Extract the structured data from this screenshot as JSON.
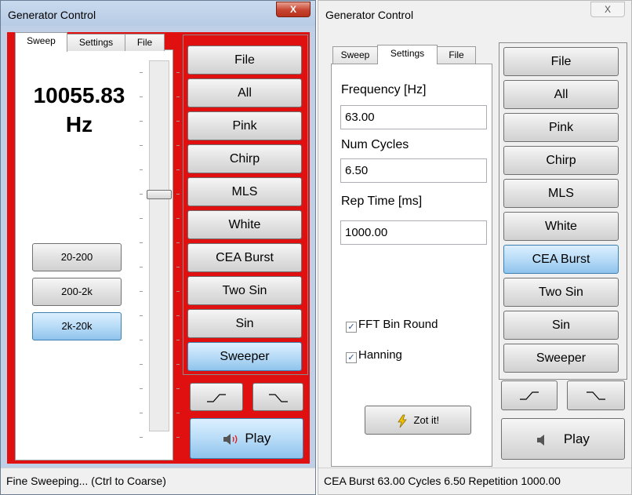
{
  "colors": {
    "accent_red": "#e01010",
    "active_blue": "#8fc3ec"
  },
  "left": {
    "title": "Generator Control",
    "close_glyph": "X",
    "tabs": [
      "Sweep",
      "Settings",
      "File"
    ],
    "frequency_value": "10055.83",
    "frequency_unit": "Hz",
    "range_buttons": [
      "20-200",
      "200-2k",
      "2k-20k"
    ],
    "mode_buttons": [
      "File",
      "All",
      "Pink",
      "Chirp",
      "MLS",
      "White",
      "CEA Burst",
      "Two Sin",
      "Sin",
      "Sweeper"
    ],
    "active_mode": "Sweeper",
    "play_label": "Play",
    "status": "Fine Sweeping... (Ctrl to Coarse)"
  },
  "right": {
    "title": "Generator Control",
    "close_glyph": "X",
    "tabs": [
      "Sweep",
      "Settings",
      "File"
    ],
    "frequency_label": "Frequency [Hz]",
    "frequency_value": "63.00",
    "cycles_label": "Num Cycles",
    "cycles_value": "6.50",
    "rep_label": "Rep Time [ms]",
    "rep_value": "1000.00",
    "fft_label": "FFT Bin Round",
    "hanning_label": "Hanning",
    "zot_label": "Zot it!",
    "mode_buttons": [
      "File",
      "All",
      "Pink",
      "Chirp",
      "MLS",
      "White",
      "CEA Burst",
      "Two Sin",
      "Sin",
      "Sweeper"
    ],
    "active_mode": "CEA Burst",
    "play_label": "Play",
    "status": "CEA Burst 63.00 Cycles 6.50 Repetition 1000.00"
  }
}
